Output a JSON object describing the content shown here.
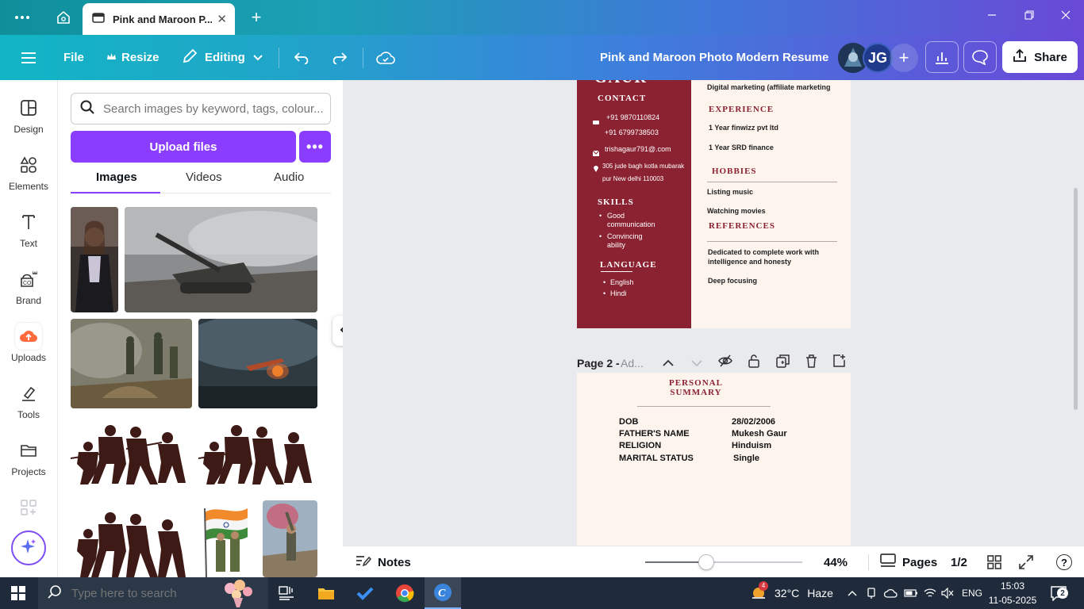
{
  "browser": {
    "tab_title": "Pink and Maroon P...",
    "tab_close": "✕",
    "new_tab": "+"
  },
  "header": {
    "file_label": "File",
    "resize_label": "Resize",
    "editing_label": "Editing",
    "doc_title": "Pink and Maroon Photo Modern Resume",
    "avatar_initials": "JG",
    "share_label": "Share"
  },
  "rail": {
    "items": [
      {
        "label": "Design",
        "icon": "design-icon"
      },
      {
        "label": "Elements",
        "icon": "elements-icon"
      },
      {
        "label": "Text",
        "icon": "text-icon"
      },
      {
        "label": "Brand",
        "icon": "brand-icon"
      },
      {
        "label": "Uploads",
        "icon": "uploads-icon"
      },
      {
        "label": "Tools",
        "icon": "tools-icon"
      },
      {
        "label": "Projects",
        "icon": "projects-icon"
      }
    ]
  },
  "panel": {
    "search_placeholder": "Search images by keyword, tags, colour...",
    "upload_label": "Upload files",
    "more_label": "•••",
    "tabs": [
      "Images",
      "Videos",
      "Audio"
    ],
    "active_tab": "Images"
  },
  "resume": {
    "name_fragment": "GAUR",
    "contact_head": "CONTACT",
    "phone1": "+91 9870110824",
    "phone2": "+91 6799738503",
    "email": "trishagaur791@.com",
    "address1": "305 jude bagh kotla mubarak",
    "address2": "pur New delhi 110003",
    "skills_head": "SKILLS",
    "skill1a": "Good",
    "skill1b": "communication",
    "skill2a": "Convincing",
    "skill2b": "ability",
    "language_head": "LANGUAGE",
    "lang1": "English",
    "lang2": "Hindi",
    "top_right": "Digital marketing (affiliate marketing",
    "experience_head": "EXPERIENCE",
    "exp1": "1 Year finwizz pvt ltd",
    "exp2": "1 Year SRD finance",
    "hobbies_head": "HOBBIES",
    "hobby1": "Listing music",
    "hobby2": "Watching movies",
    "references_head": "REFERENCES",
    "ref1a": "Dedicated to complete work with",
    "ref1b": "intelligence and honesty",
    "ref2": "Deep focusing"
  },
  "page2": {
    "bar_label": "Page 2 - ",
    "bar_placeholder": "Ad...",
    "summary_head1": "PERSONAL",
    "summary_head2": "SUMMARY",
    "rows": [
      {
        "label": "DOB",
        "value": "28/02/2006"
      },
      {
        "label": "FATHER'S NAME",
        "value": "Mukesh Gaur"
      },
      {
        "label": "RELIGION",
        "value": "Hinduism"
      },
      {
        "label": "MARITAL STATUS",
        "value": "Single"
      }
    ]
  },
  "statusbar": {
    "notes_label": "Notes",
    "zoom_label": "44%",
    "zoom_level": 0.44,
    "pages_label": "Pages",
    "page_count": "1/2",
    "help": "?"
  },
  "taskbar": {
    "search_placeholder": "Type here to search",
    "weather_temp": "32°C",
    "weather_desc": "Haze",
    "weather_badge": "4",
    "lang": "ENG",
    "time": "15:03",
    "date": "11-05-2025",
    "notifications": "2"
  },
  "colors": {
    "accent": "#8b3dff",
    "resume_maroon": "#8b2232",
    "resume_bg": "#fdf4ee"
  }
}
